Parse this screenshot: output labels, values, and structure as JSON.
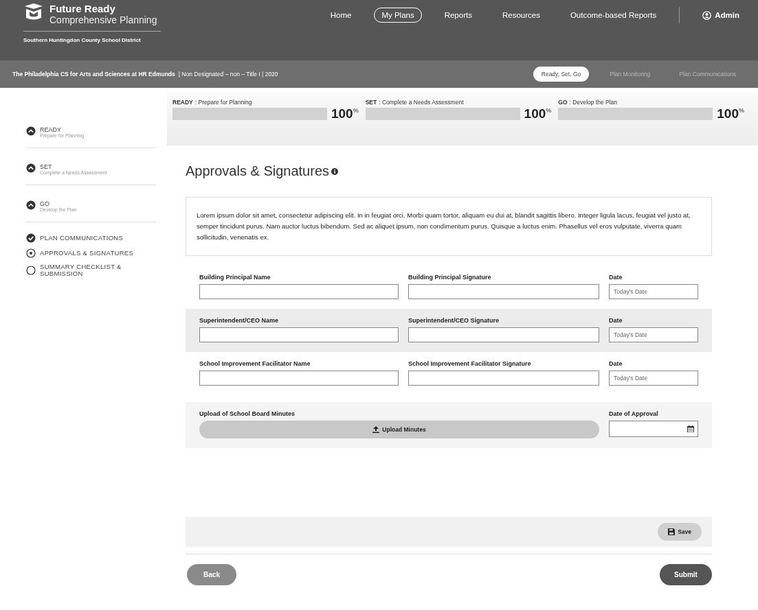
{
  "header": {
    "logo_title": "Future Ready",
    "logo_subtitle": "Comprehensive Planning",
    "district": "Southern Huntingdon County School District",
    "nav": [
      {
        "label": "Home",
        "selected": false
      },
      {
        "label": "My Plans",
        "selected": true
      },
      {
        "label": "Reports",
        "selected": false
      },
      {
        "label": "Resources",
        "selected": false
      },
      {
        "label": "Outcome-based Reports",
        "selected": false
      }
    ],
    "user": "Admin"
  },
  "subbar": {
    "school": "The Philadelphia CS for Arts and Sciences at HR Edmunds",
    "details": "|  Non Designated – non – Title I  |  2020",
    "tabs": [
      {
        "label": "Ready, Set, Go",
        "selected": true
      },
      {
        "label": "Plan Monitoring",
        "selected": false
      },
      {
        "label": "Plan Communications",
        "selected": false
      }
    ]
  },
  "sidebar": [
    {
      "kind": "stage",
      "title": "READY",
      "subtitle": "Prepare for Planning"
    },
    {
      "kind": "stage",
      "title": "SET",
      "subtitle": "Complete a Needs Assessment"
    },
    {
      "kind": "stage",
      "title": "GO",
      "subtitle": "Develop the Plan"
    },
    {
      "kind": "section",
      "title": "PLAN COMMUNICATIONS",
      "completed": true,
      "selected": false
    },
    {
      "kind": "section",
      "title": "APPROVALS & SIGNATURES",
      "completed": false,
      "selected": true
    },
    {
      "kind": "section",
      "title": "SUMMARY CHECKLIST & SUBMISSION",
      "completed": false,
      "selected": false
    }
  ],
  "progress": [
    {
      "step": "READY",
      "description": ": Prepare for Planning",
      "level": 1,
      "reading": "100",
      "unit": "%"
    },
    {
      "step": "SET",
      "description": ": Complete a Needs Assessment",
      "level": 1,
      "reading": "100",
      "unit": "%"
    },
    {
      "step": "GO",
      "description": ": Develop the Plan",
      "level": 1,
      "reading": "100",
      "unit": "%"
    }
  ],
  "title": "Approvals & Signatures",
  "intro": "Lorem ipsum dolor sit amet, consectetur adipiscing elit. In in feugiat orci. Morbi quam tortor, aliquam eu dui at, blandit sagittis libero. Integer ligula lacus, feugiat vel justo at, semper tincidunt purus. Nam auctor luctus bibendum. Sed ac aliquet ipsum, non condimentum purus. Quisque a luctus enim. Phasellus vel eros vulputate, viverra quam sollicitudin, venenatis ex.",
  "signature_rows": [
    {
      "shaded": false,
      "name_label": "Building Principal Name",
      "signature_label": "Building Principal Signature",
      "date_label": "Date",
      "date_placeholder": "Today's Date"
    },
    {
      "shaded": true,
      "name_label": "Superintendent/CEO Name",
      "signature_label": "Superintendent/CEO Signature",
      "date_label": "Date",
      "date_placeholder": "Today's Date"
    },
    {
      "shaded": false,
      "name_label": "School Improvement Facilitator Name",
      "signature_label": "School Improvement Facilitator Signature",
      "date_label": "Date",
      "date_placeholder": "Today's Date"
    }
  ],
  "upload": {
    "label": "Upload of School Board Minutes",
    "button": "Upload Minutes",
    "date_label": "Date of Approval"
  },
  "save_button": "Save",
  "back_button": "Back",
  "submit_button": "Submit"
}
